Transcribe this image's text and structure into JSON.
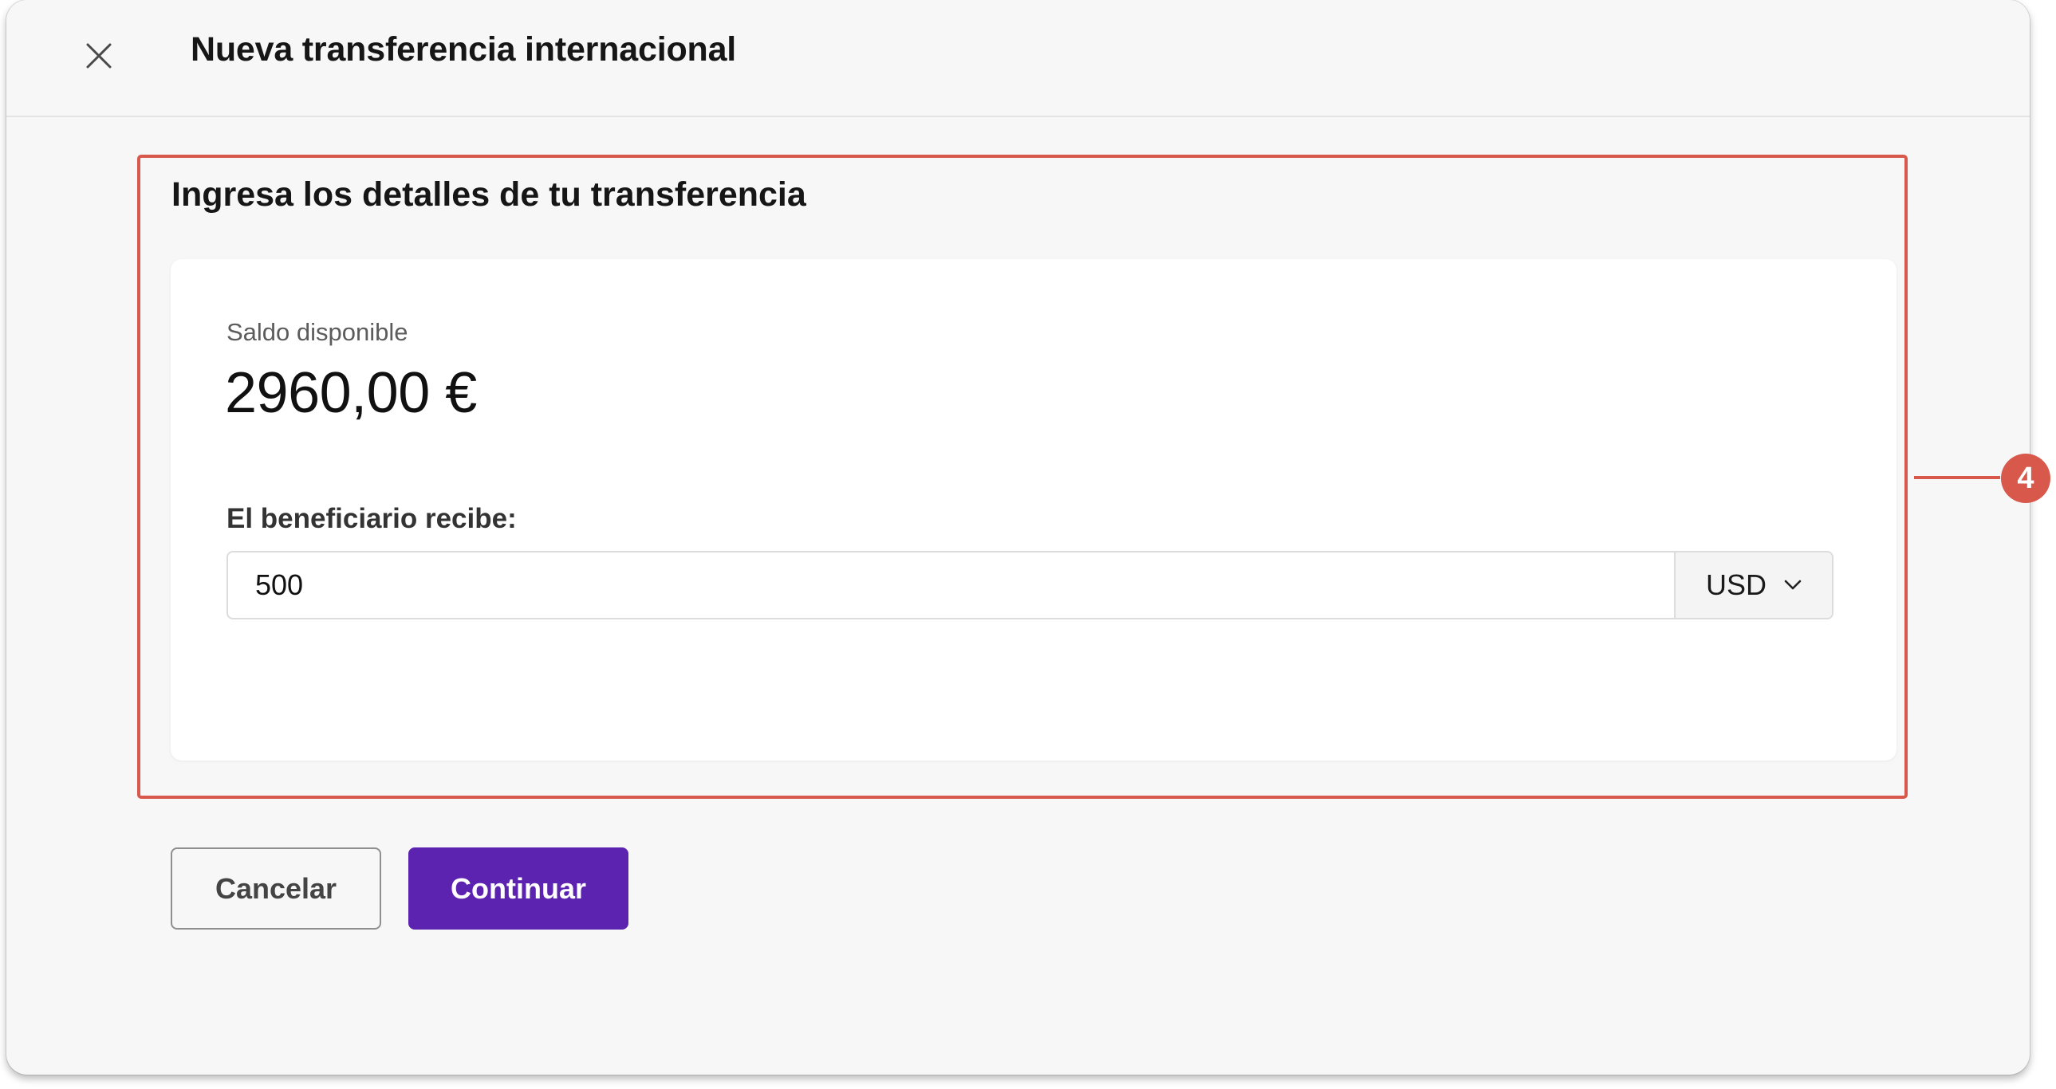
{
  "modal": {
    "title": "Nueva transferencia internacional",
    "close_icon": "close-icon"
  },
  "section": {
    "heading": "Ingresa los detalles de tu transferencia"
  },
  "balance": {
    "label": "Saldo disponible",
    "value": "2960,00 €"
  },
  "transfer": {
    "recipient_label": "El beneficiario recibe:",
    "amount_value": "500",
    "currency": "USD",
    "currency_icon": "chevron-down-icon"
  },
  "annotation": {
    "number": "4",
    "color": "#d8584c"
  },
  "actions": {
    "cancel_label": "Cancelar",
    "continue_label": "Continuar",
    "continue_color": "#5c22b0"
  }
}
